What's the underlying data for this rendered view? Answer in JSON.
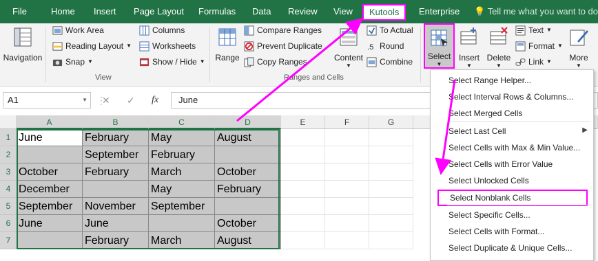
{
  "ribbon_tabs": [
    "File",
    "Home",
    "Insert",
    "Page Layout",
    "Formulas",
    "Data",
    "Review",
    "View",
    "Kutools",
    "Enterprise"
  ],
  "tell_me": "Tell me what you want to do...",
  "ribbon": {
    "navigation": "Navigation",
    "view_group": {
      "work_area": "Work Area",
      "reading_layout": "Reading Layout",
      "snap": "Snap",
      "columns": "Columns",
      "worksheets": "Worksheets",
      "show_hide": "Show / Hide",
      "label": "View"
    },
    "range": "Range",
    "ranges_group": {
      "compare_ranges": "Compare Ranges",
      "prevent_duplicate": "Prevent Duplicate",
      "copy_ranges": "Copy Ranges",
      "content": "Content",
      "to_actual": "To Actual",
      "round": "Round",
      "combine": "Combine",
      "label": "Ranges and Cells"
    },
    "select": "Select",
    "insert": "Insert",
    "delete": "Delete",
    "text": "Text",
    "format": "Format",
    "link": "Link",
    "more": "More"
  },
  "formula_bar": {
    "name_box": "A1",
    "value": "June",
    "cancel": "✕",
    "enter": "✓",
    "fx": "fx"
  },
  "sheet": {
    "columns": [
      "A",
      "B",
      "C",
      "D",
      "E",
      "F",
      "G"
    ],
    "rows": [
      [
        "June",
        "February",
        "May",
        "August"
      ],
      [
        "",
        "September",
        "February",
        ""
      ],
      [
        "October",
        "February",
        "March",
        "October"
      ],
      [
        "December",
        "",
        "May",
        "February"
      ],
      [
        "September",
        "November",
        "September",
        ""
      ],
      [
        "June",
        "June",
        "",
        "October"
      ],
      [
        "",
        "February",
        "March",
        "August"
      ]
    ],
    "row_numbers": [
      "1",
      "2",
      "3",
      "4",
      "5",
      "6",
      "7"
    ]
  },
  "select_menu": [
    "Select Range Helper...",
    "Select Interval Rows & Columns...",
    "Select Merged Cells",
    "Select Last Cell",
    "Select Cells with Max & Min Value...",
    "Select Cells with Error Value",
    "Select Unlocked Cells",
    "Select Nonblank Cells",
    "Select Specific Cells...",
    "Select Cells with Format...",
    "Select Duplicate & Unique Cells..."
  ],
  "colors": {
    "excel_green": "#217346",
    "highlight": "#ff00ff",
    "selected_fill": "#c8c8c8"
  }
}
